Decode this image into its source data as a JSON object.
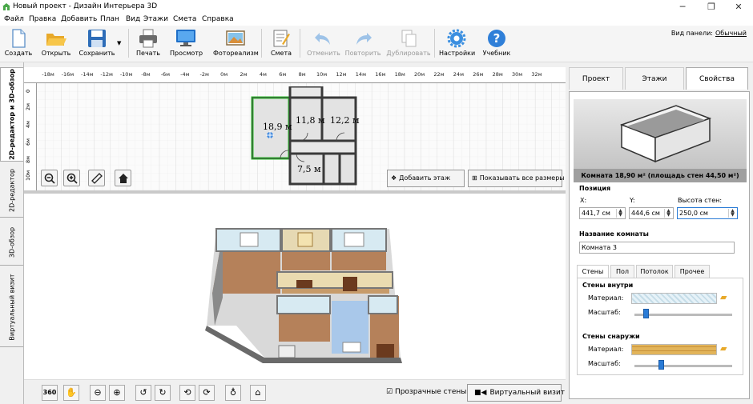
{
  "window": {
    "title": "Новый проект - Дизайн Интерьера 3D",
    "minimize": "─",
    "maximize": "❐",
    "close": "✕"
  },
  "menu": [
    "Файл",
    "Правка",
    "Добавить",
    "План",
    "Вид",
    "Этажи",
    "Смета",
    "Справка"
  ],
  "toolbar": {
    "items": [
      {
        "label": "Создать",
        "icon": "new-file-icon"
      },
      {
        "label": "Открыть",
        "icon": "folder-open-icon"
      },
      {
        "label": "Сохранить",
        "icon": "save-icon"
      },
      {
        "label": "Печать",
        "icon": "printer-icon"
      },
      {
        "label": "Просмотр",
        "icon": "monitor-icon"
      },
      {
        "label": "Фотореализм",
        "icon": "photo-icon"
      },
      {
        "label": "Смета",
        "icon": "estimate-icon"
      },
      {
        "label": "Отменить",
        "icon": "undo-icon",
        "disabled": true
      },
      {
        "label": "Повторить",
        "icon": "redo-icon",
        "disabled": true
      },
      {
        "label": "Дублировать",
        "icon": "duplicate-icon",
        "disabled": true
      },
      {
        "label": "Настройки",
        "icon": "gear-icon"
      },
      {
        "label": "Учебник",
        "icon": "help-icon"
      }
    ],
    "view_mode_label": "Вид панели:",
    "view_mode_value": "Обычный"
  },
  "left_tabs": [
    "2D-редактор и 3D-обзор",
    "2D-редактор",
    "3D-обзор",
    "Виртуальный визит"
  ],
  "ruler": {
    "top": [
      "-18м",
      "-16м",
      "-14м",
      "-12м",
      "-10м",
      "-8м",
      "-6м",
      "-4м",
      "-2м",
      "0м",
      "2м",
      "4м",
      "6м",
      "8м",
      "10м",
      "12м",
      "14м",
      "16м",
      "18м",
      "20м",
      "22м",
      "24м",
      "26м",
      "28м",
      "30м",
      "32м"
    ],
    "left": [
      "0",
      "2м",
      "4м",
      "6м",
      "8м",
      "10м"
    ]
  },
  "plan": {
    "rooms": [
      {
        "name": "room-1",
        "label": "18,9 м"
      },
      {
        "name": "room-2",
        "label": "11,8 м"
      },
      {
        "name": "room-3",
        "label": "12,2 м"
      },
      {
        "name": "room-4",
        "label": "7,5 м"
      }
    ],
    "add_floor": "Добавить этаж",
    "show_dims": "Показывать все размеры"
  },
  "bottom": {
    "transparent_walls": "Прозрачные стены",
    "virtual_visit": "Виртуальный визит"
  },
  "right": {
    "tabs": [
      "Проект",
      "Этажи",
      "Свойства"
    ],
    "active_tab": "Свойства",
    "preview_caption": "Комната 18,90 м²  (площадь стен 44,50 м²)",
    "position": {
      "title": "Позиция",
      "x_label": "X:",
      "x_value": "441,7 см",
      "y_label": "Y:",
      "y_value": "444,6 см",
      "h_label": "Высота стен:",
      "h_value": "250,0 см"
    },
    "room_name": {
      "title": "Название комнаты",
      "value": "Комната 3"
    },
    "subtabs": [
      "Стены",
      "Пол",
      "Потолок",
      "Прочее"
    ],
    "walls_inside": {
      "title": "Стены внутри",
      "material_label": "Материал:",
      "scale_label": "Масштаб:",
      "scale_value": 0.12
    },
    "walls_outside": {
      "title": "Стены снаружи",
      "material_label": "Материал:",
      "scale_label": "Масштаб:",
      "scale_value": 0.28
    }
  },
  "colors": {
    "accent": "#2a7bd6",
    "selected_room": "#2ec12e",
    "wall": "#3a3a3a",
    "floor_wood": "#b5815a",
    "wallpaper": "#d7eaf2",
    "brick": "#e2b45a"
  }
}
